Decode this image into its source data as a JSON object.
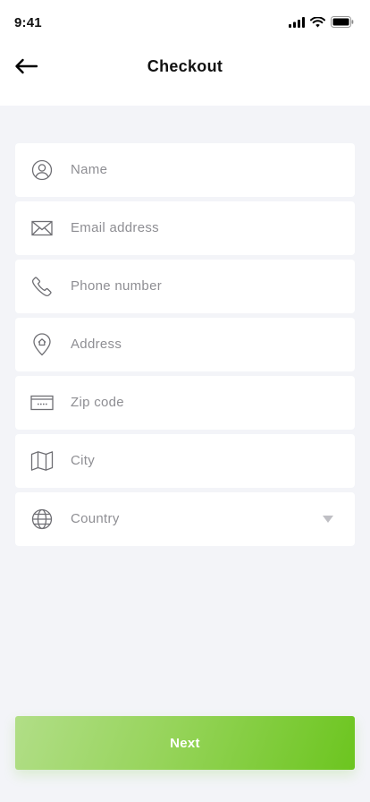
{
  "status_bar": {
    "time": "9:41",
    "icons": [
      "signal-icon",
      "wifi-icon",
      "battery-icon"
    ]
  },
  "header": {
    "back_icon": "back-arrow-icon",
    "title": "Checkout"
  },
  "form": {
    "fields": [
      {
        "icon": "user-icon",
        "placeholder": "Name"
      },
      {
        "icon": "mail-icon",
        "placeholder": "Email address"
      },
      {
        "icon": "phone-icon",
        "placeholder": "Phone number"
      },
      {
        "icon": "location-pin-icon",
        "placeholder": "Address"
      },
      {
        "icon": "zip-code-icon",
        "placeholder": "Zip code"
      },
      {
        "icon": "map-icon",
        "placeholder": "City"
      },
      {
        "icon": "globe-icon",
        "placeholder": "Country",
        "type": "select",
        "caret_icon": "dropdown-caret-icon"
      }
    ]
  },
  "actions": {
    "next_label": "Next"
  },
  "colors": {
    "background": "#F3F4F8",
    "card": "#FFFFFF",
    "placeholder": "#8E8E93",
    "icon": "#6E6E73",
    "accent_start": "#B1DE87",
    "accent_end": "#6CC51F"
  }
}
